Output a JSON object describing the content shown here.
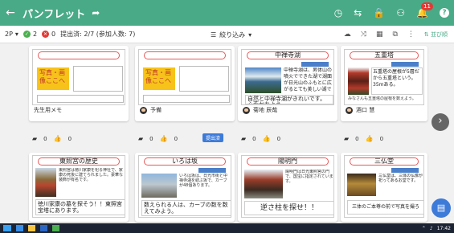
{
  "appbar": {
    "back_icon": "←",
    "title": "パンフレット",
    "share_icon": "➦",
    "notif_count": "11",
    "help_label": "?"
  },
  "toolbar": {
    "page": "2P",
    "green_count": "2",
    "red_count": "0",
    "submitted": "提出済: 2/7 (参加人数: 7)",
    "filter_label": "絞り込み",
    "sort_label": "並び順"
  },
  "cards": [
    {
      "title": "",
      "img_label": "写真・画像ここへ",
      "owner": "先生用メモ",
      "comments": "0",
      "likes": "0"
    },
    {
      "title": "",
      "img_label": "写真・画像ここへ",
      "owner": "予備",
      "comments": "0",
      "likes": "0",
      "status": "提出済"
    },
    {
      "title": "中禅寺湖",
      "desc": "中禅寺湖は、男体山の噴火でできた湖で湖面が日光山のふもとに広がるとても美しい湖です。",
      "caption": "自然と中禅寺湖がきれいです。心惹かれよう。",
      "owner": "菊地 辰哉",
      "comments": "0",
      "likes": "0"
    },
    {
      "title": "五重塔",
      "desc": "五重塔の屋根が5層だから五重塔という。35mある。",
      "caption": "みなさんも五重塔の屋根を数えよう。",
      "owner": "酒口 慧",
      "comments": "0",
      "likes": "0"
    },
    {
      "title": "東照宮の歴史",
      "small": "東照宮は徳川家康を祀る神社で、家康の死後に建てられました。豪華な装飾が有名です。",
      "caption": "徳川家康の墓を探そう！！東照宮宝塔にあります。"
    },
    {
      "title": "いろは坂",
      "small": "いろは坂は、日光市街と中禅寺湖を結ぶ坂で、カーブが48個あります。",
      "caption": "数えられる人は、カーブの数を数えてみよう。"
    },
    {
      "title": "陽明門",
      "small": "陽明門は日光東照宮の門で、国宝に指定されています。",
      "caption": "逆さ柱を探せ！！"
    },
    {
      "title": "三仏堂",
      "desc": "三仏堂は、三体の仏像が祀ってあるお堂です。",
      "caption": "三体のご本尊の前で写真を撮ろう。"
    }
  ],
  "taskbar": {
    "time": "17:42"
  }
}
